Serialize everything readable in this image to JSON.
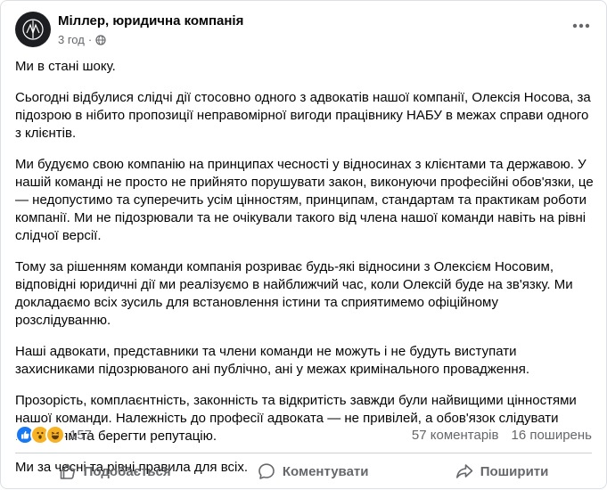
{
  "post": {
    "author": "Міллер, юридична компанія",
    "time": "3 год",
    "paragraphs": [
      "Ми в стані шоку.",
      "Сьогодні відбулися слідчі дії стосовно одного з адвокатів нашої компанії, Олексія Носова, за підозрою в нібито пропозиції неправомірної вигоди працівнику НАБУ в межах справи одного з клієнтів.",
      "Ми будуємо свою компанію на принципах чесності у відносинах з клієнтами та державою. У нашій команді не просто не прийнято порушувати закон, виконуючи професійні обов'язки, це — недопустимо та суперечить усім цінностям, принципам, стандартам та практикам роботи компанії. Ми не підозрювали та не очікували такого від члена нашої команди навіть на рівні слідчої версії.",
      "Тому за рішенням команди компанія розриває будь-які відносини з Олексієм Носовим, відповідні юридичні дії ми реалізуємо в найближчий час, коли Олексій буде на зв'язку. Ми докладаємо всіх зусиль для встановлення істини та сприятимемо офіційному розслідуванню.",
      "Наші адвокати, представники та члени команди не можуть і не будуть виступати захисниками підозрюваного ані публічно, ані у межах кримінального провадження.",
      "Прозорість, комплаєнтність, законність та відкритість завжди були найвищими цінностями нашої команди. Належність до професії адвоката — не привілей, а обов'язок слідувати цінностям та берегти репутацію.",
      "Ми за чесні та рівні правила для всіх."
    ]
  },
  "stats": {
    "reactions_count": "157",
    "reaction_icons": [
      "like",
      "wow",
      "haha"
    ],
    "comments": "57 коментарів",
    "shares": "16 поширень"
  },
  "actions": {
    "like": "Подобається",
    "comment": "Коментувати",
    "share": "Поширити"
  },
  "colors": {
    "like_blue": "#1877f2",
    "emoji_yellow": "#f7b125",
    "secondary_text": "#65676b"
  }
}
